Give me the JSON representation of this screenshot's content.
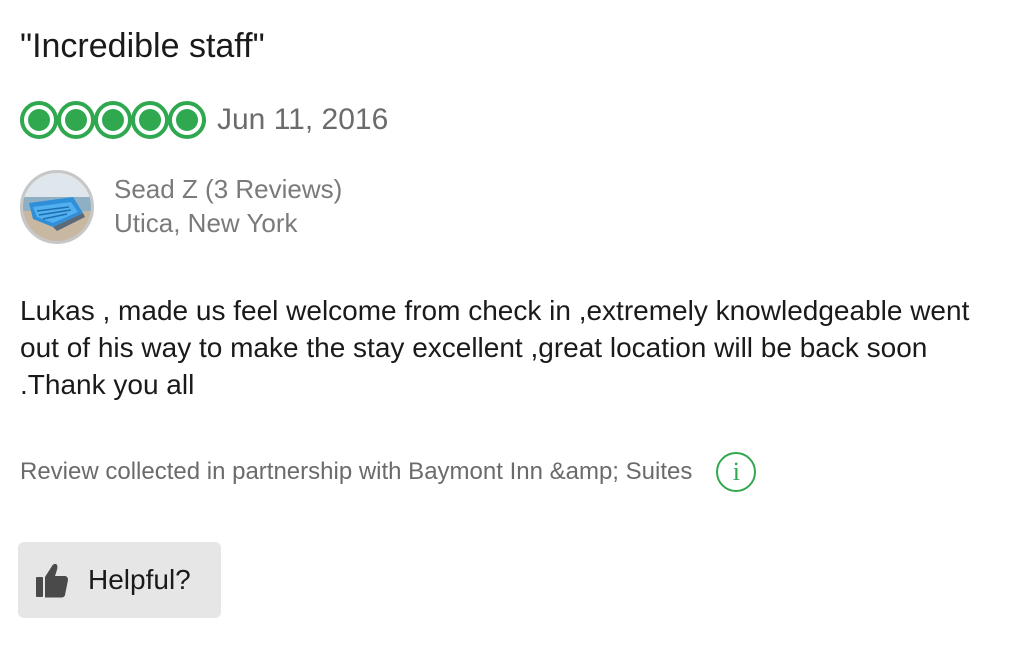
{
  "review": {
    "title": "\"Incredible staff\"",
    "rating": {
      "value": 5,
      "max": 5,
      "color": "#2fa84f"
    },
    "date": "Jun 11, 2016",
    "author": {
      "name": "Sead Z (3 Reviews)",
      "location": "Utica, New York",
      "avatar_icon": "avatar-boat-photo"
    },
    "body": "Lukas , made us feel welcome from check in ,extremely knowledgeable went out of his way to make the stay excellent ,great location will be back soon .Thank you all",
    "partnership": {
      "text": "Review collected in partnership with Baymont Inn &amp; Suites",
      "icon": "info-icon"
    },
    "helpful": {
      "label": "Helpful?",
      "icon": "thumbs-up-icon"
    }
  }
}
